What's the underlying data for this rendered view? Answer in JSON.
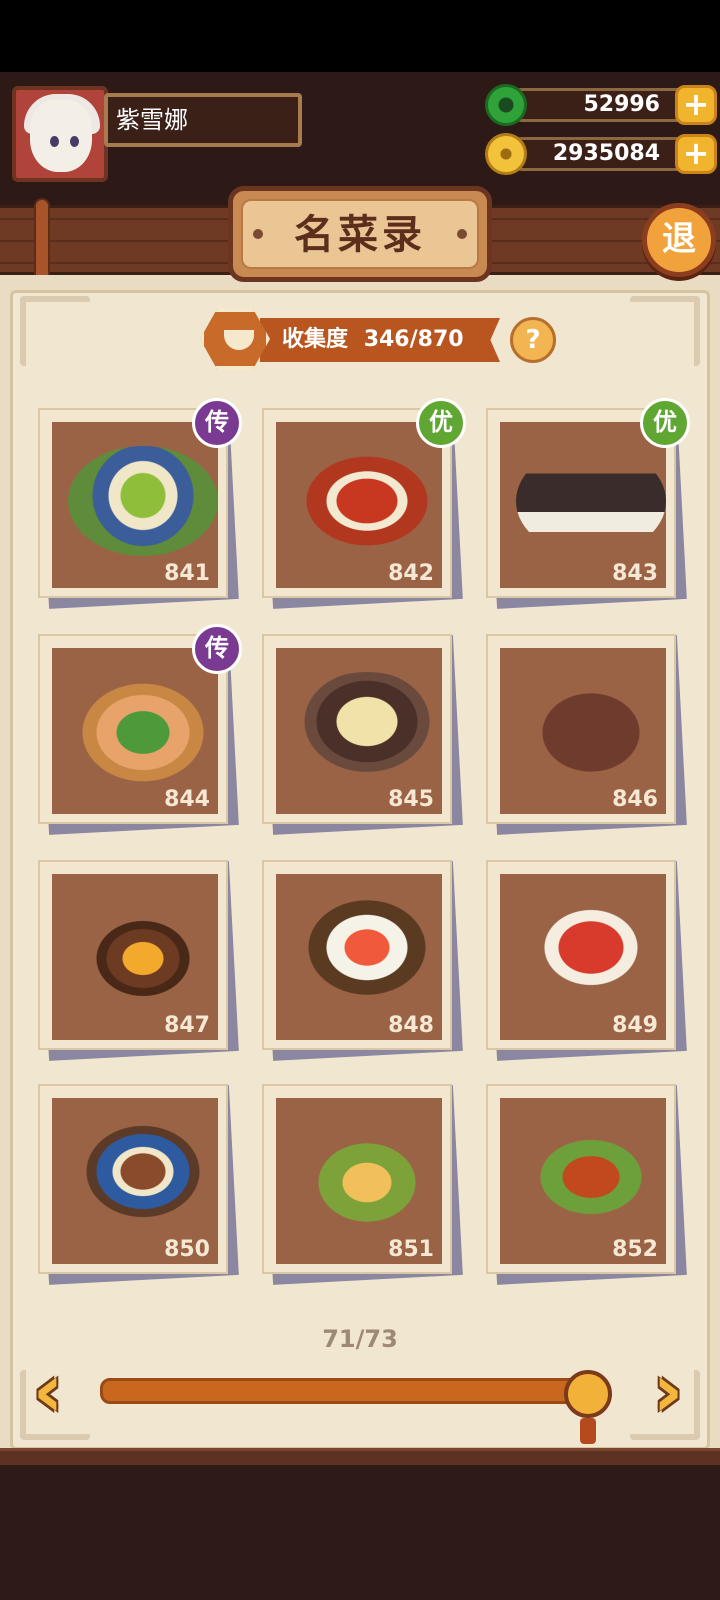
{
  "player": {
    "name": "紫雪娜"
  },
  "currencies": [
    {
      "name": "jade",
      "value": "52996",
      "plus": "+"
    },
    {
      "name": "gold",
      "value": "2935084",
      "plus": "+"
    }
  ],
  "title": "名菜录",
  "exit_label": "退",
  "collection": {
    "label": "收集度",
    "value": "346/870"
  },
  "help_label": "?",
  "badges": {
    "legend": "传",
    "good": "优"
  },
  "dishes": [
    {
      "number": "841",
      "badge": "传"
    },
    {
      "number": "842",
      "badge": "优"
    },
    {
      "number": "843",
      "badge": "优"
    },
    {
      "number": "844",
      "badge": "传"
    },
    {
      "number": "845",
      "badge": ""
    },
    {
      "number": "846",
      "badge": ""
    },
    {
      "number": "847",
      "badge": ""
    },
    {
      "number": "848",
      "badge": ""
    },
    {
      "number": "849",
      "badge": ""
    },
    {
      "number": "850",
      "badge": ""
    },
    {
      "number": "851",
      "badge": ""
    },
    {
      "number": "852",
      "badge": ""
    }
  ],
  "pagination": {
    "indicator": "71/73",
    "current": 71,
    "total": 73,
    "prev": "‹",
    "next": "›"
  },
  "colors": {
    "legend_badge": "#7a3a92",
    "good_badge": "#5fa633",
    "accent": "#f2b23a"
  }
}
